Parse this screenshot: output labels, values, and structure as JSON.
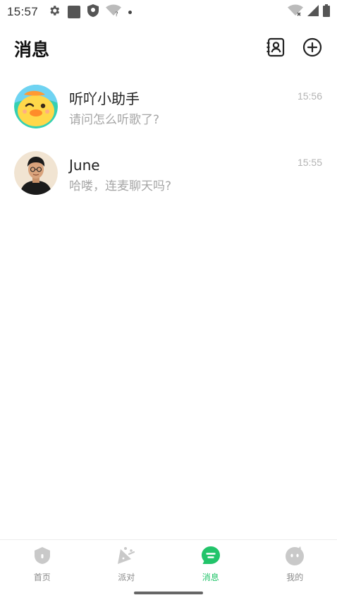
{
  "status_bar": {
    "time": "15:57",
    "left_icons": [
      "gear-icon",
      "square-icon",
      "shield-icon",
      "wifi-question-icon",
      "dot-icon"
    ],
    "right_icons": [
      "wifi-icon",
      "cell-signal-icon",
      "battery-icon"
    ]
  },
  "header": {
    "title": "消息",
    "actions": [
      "contacts-icon",
      "add-circle-icon"
    ]
  },
  "conversations": [
    {
      "name": "听吖小助手",
      "preview": "请问怎么听歌了?",
      "time": "15:56",
      "avatar": "duck-avatar"
    },
    {
      "name": "June",
      "preview": "哈喽，连麦聊天吗?",
      "time": "15:55",
      "avatar": "man-avatar"
    }
  ],
  "bottom_nav": {
    "items": [
      {
        "label": "首页",
        "icon": "home-shield-icon",
        "active": false
      },
      {
        "label": "派对",
        "icon": "party-icon",
        "active": false
      },
      {
        "label": "消息",
        "icon": "message-icon",
        "active": true
      },
      {
        "label": "我的",
        "icon": "profile-face-icon",
        "active": false
      }
    ]
  },
  "colors": {
    "accent": "#22c46a",
    "inactive_nav": "#8a8a8a",
    "preview_text": "#a6a6a6",
    "time_text": "#b3b3b3"
  }
}
